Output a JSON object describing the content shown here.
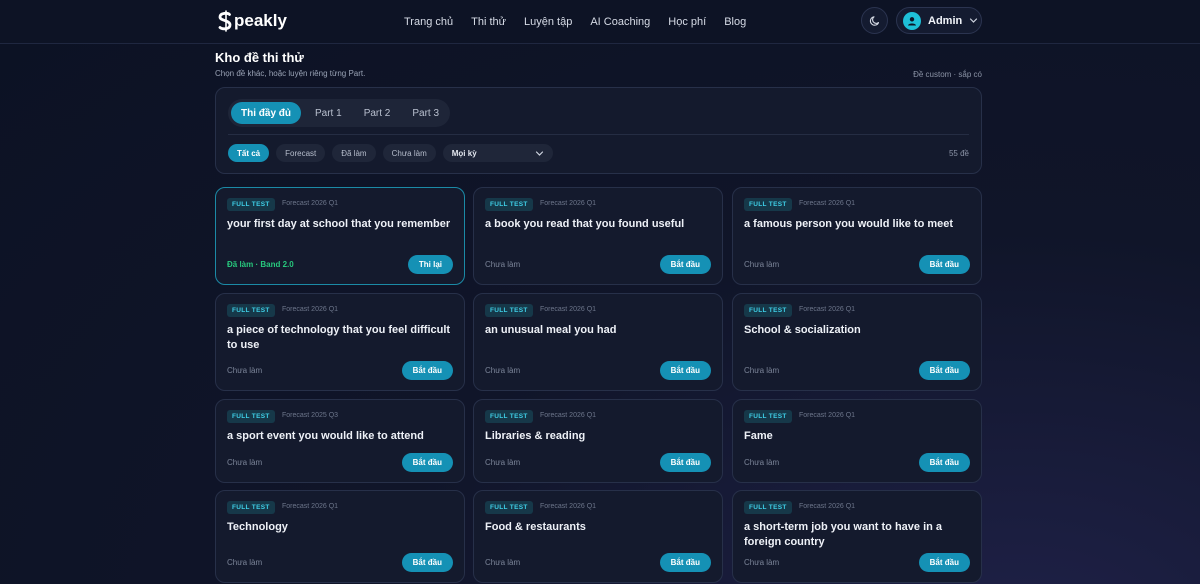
{
  "header": {
    "logo_text": "peakly",
    "nav": [
      "Trang chủ",
      "Thi thử",
      "Luyện tập",
      "AI Coaching",
      "Học phí",
      "Blog"
    ],
    "user_name": "Admin"
  },
  "page": {
    "title": "Kho đề thi thử",
    "subtitle": "Chọn đề khác, hoặc luyện riêng từng Part.",
    "note": "Đề custom · sắp có"
  },
  "filters": {
    "tabs": [
      "Thi đầy đủ",
      "Part 1",
      "Part 2",
      "Part 3"
    ],
    "active_tab": 0,
    "chips": [
      "Tất cả",
      "Forecast",
      "Đã làm",
      "Chưa làm"
    ],
    "active_chip": 0,
    "period_select": "Mọi kỳ",
    "count": "55 đề"
  },
  "cards": [
    {
      "badge": "FULL TEST",
      "forecast": "Forecast 2026 Q1",
      "title": "your first day at school that you remember",
      "status": "Đã làm · Band 2.0",
      "done": true,
      "action": "Thi lại"
    },
    {
      "badge": "FULL TEST",
      "forecast": "Forecast 2026 Q1",
      "title": "a book you read that you found useful",
      "status": "Chưa làm",
      "done": false,
      "action": "Bắt đầu"
    },
    {
      "badge": "FULL TEST",
      "forecast": "Forecast 2026 Q1",
      "title": "a famous person you would like to meet",
      "status": "Chưa làm",
      "done": false,
      "action": "Bắt đầu"
    },
    {
      "badge": "FULL TEST",
      "forecast": "Forecast 2026 Q1",
      "title": "a piece of technology that you feel difficult to use",
      "status": "Chưa làm",
      "done": false,
      "action": "Bắt đầu"
    },
    {
      "badge": "FULL TEST",
      "forecast": "Forecast 2026 Q1",
      "title": "an unusual meal you had",
      "status": "Chưa làm",
      "done": false,
      "action": "Bắt đầu"
    },
    {
      "badge": "FULL TEST",
      "forecast": "Forecast 2026 Q1",
      "title": "School & socialization",
      "status": "Chưa làm",
      "done": false,
      "action": "Bắt đầu"
    },
    {
      "badge": "FULL TEST",
      "forecast": "Forecast 2025 Q3",
      "title": "a sport event you would like to attend",
      "status": "Chưa làm",
      "done": false,
      "action": "Bắt đầu"
    },
    {
      "badge": "FULL TEST",
      "forecast": "Forecast 2026 Q1",
      "title": "Libraries & reading",
      "status": "Chưa làm",
      "done": false,
      "action": "Bắt đầu"
    },
    {
      "badge": "FULL TEST",
      "forecast": "Forecast 2026 Q1",
      "title": "Fame",
      "status": "Chưa làm",
      "done": false,
      "action": "Bắt đầu"
    },
    {
      "badge": "FULL TEST",
      "forecast": "Forecast 2026 Q1",
      "title": "Technology",
      "status": "Chưa làm",
      "done": false,
      "action": "Bắt đầu"
    },
    {
      "badge": "FULL TEST",
      "forecast": "Forecast 2026 Q1",
      "title": "Food & restaurants",
      "status": "Chưa làm",
      "done": false,
      "action": "Bắt đầu"
    },
    {
      "badge": "FULL TEST",
      "forecast": "Forecast 2026 Q1",
      "title": "a short-term job you want to have in a foreign country",
      "status": "Chưa làm",
      "done": false,
      "action": "Bắt đầu"
    }
  ]
}
